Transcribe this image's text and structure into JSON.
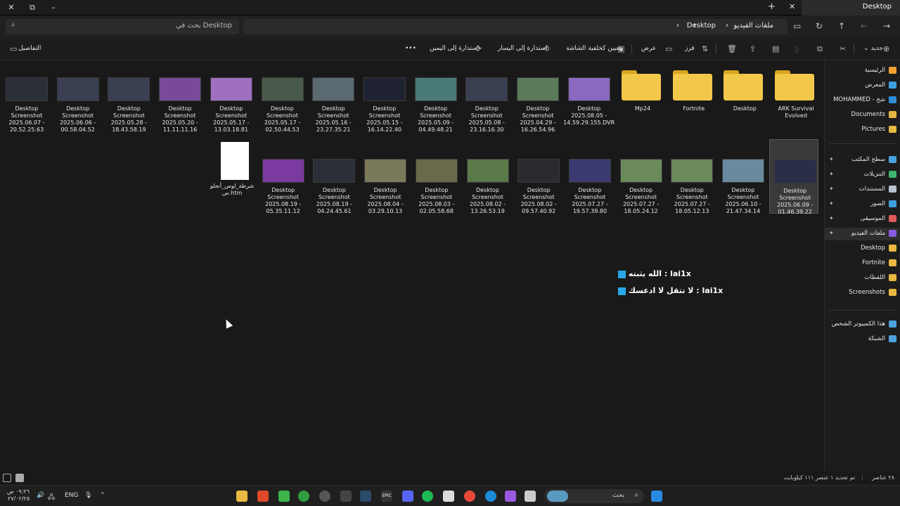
{
  "window": {
    "tab_title": "Desktop",
    "min_icon": "minimize-icon",
    "max_icon": "maximize-icon",
    "close_icon": "close-icon"
  },
  "address": {
    "crumbs": [
      "ملفات الفيديو",
      "Desktop"
    ],
    "search_placeholder": "بحث في Desktop"
  },
  "commands": {
    "new": "جديد",
    "sort": "فرز",
    "view": "عرض",
    "set_wallpaper": "تعيين كخلفية الشاشة",
    "rotate_left": "استدارة إلى اليسار",
    "rotate_right": "استدارة إلى اليمين",
    "more": "•••",
    "details": "التفاصيل"
  },
  "sidebar": {
    "items": [
      {
        "label": "الرئيسية",
        "color": "#f0a030"
      },
      {
        "label": "المعرض",
        "color": "#3da0e0"
      },
      {
        "label": "MOHAMMED - شخ",
        "color": "#2b8bd9"
      },
      {
        "label": "Documents",
        "color": "#e8b840"
      },
      {
        "label": "Pictures",
        "color": "#e8b840"
      },
      {
        "label": "سطح المكتب",
        "color": "#4aa3e0"
      },
      {
        "label": "التنزيلات",
        "color": "#3cb46e"
      },
      {
        "label": "المستندات",
        "color": "#b8c4d0"
      },
      {
        "label": "الصور",
        "color": "#3da0e0"
      },
      {
        "label": "الموسيقى",
        "color": "#e05a5a"
      },
      {
        "label": "ملفات الفيديو",
        "color": "#8a5ae0"
      },
      {
        "label": "Desktop",
        "color": "#e8b840"
      },
      {
        "label": "Fortnite",
        "color": "#e8b840"
      },
      {
        "label": "اللقطات",
        "color": "#e8b840"
      },
      {
        "label": "Screenshots",
        "color": "#e8b840"
      },
      {
        "label": "هذا الكمبيوتر الشخص",
        "color": "#4aa3e0"
      },
      {
        "label": "الشبكة",
        "color": "#4aa3e0"
      }
    ]
  },
  "files_row1": [
    {
      "l1": "Desktop",
      "l2": "Screenshot",
      "l3": "2025.06.07 -",
      "l4": "20.52.25.63",
      "color": "#2a2f38"
    },
    {
      "l1": "Desktop",
      "l2": "Screenshot",
      "l3": "2025.06.06 -",
      "l4": "00.58.04.52",
      "color": "#3a3f52"
    },
    {
      "l1": "Desktop",
      "l2": "Screenshot",
      "l3": "2025.05.28 -",
      "l4": "18.43.58.19",
      "color": "#3a3f52"
    },
    {
      "l1": "Desktop",
      "l2": "Screenshot",
      "l3": "2025.05.20 -",
      "l4": "11.11.11.16",
      "color": "#7a4a9a"
    },
    {
      "l1": "Desktop",
      "l2": "Screenshot",
      "l3": "2025.05.17 -",
      "l4": "13.03.18.81",
      "color": "#a070c0"
    },
    {
      "l1": "Desktop",
      "l2": "Screenshot",
      "l3": "2025.05.17 -",
      "l4": "02.50.44.53",
      "color": "#4a5a4a"
    },
    {
      "l1": "Desktop",
      "l2": "Screenshot",
      "l3": "2025.05.16 -",
      "l4": "23.27.35.21",
      "color": "#5a6a70"
    },
    {
      "l1": "Desktop",
      "l2": "Screenshot",
      "l3": "2025.05.15 -",
      "l4": "16.14.22.40",
      "color": "#1f2230"
    },
    {
      "l1": "Desktop",
      "l2": "Screenshot",
      "l3": "2025.05.09 -",
      "l4": "04.49.48.21",
      "color": "#4a7a78"
    },
    {
      "l1": "Desktop",
      "l2": "Screenshot",
      "l3": "2025.05.08 -",
      "l4": "23.16.16.30",
      "color": "#3a3f52"
    },
    {
      "l1": "Desktop",
      "l2": "Screenshot",
      "l3": "2025.04.29 -",
      "l4": "16.26.54.96",
      "color": "#5a7a5a"
    },
    {
      "l1": "Desktop",
      "l2": "2025.08.05 -",
      "l3": "14.59.29.155.DVR",
      "l4": "",
      "color": "#8a6ac0"
    }
  ],
  "folders": [
    {
      "label": "Mp24"
    },
    {
      "label": "Fortnite"
    },
    {
      "label": "Desktop"
    },
    {
      "label": "ARK Survival Evolved"
    }
  ],
  "files_row2": [
    {
      "l1": "شرطة_لوس_أنجلو",
      "l2": "س.htm",
      "l3": "",
      "l4": "",
      "color": "#ffffff"
    },
    {
      "l1": "Desktop",
      "l2": "Screenshot",
      "l3": "2025.08.19 -",
      "l4": "05.35.11.12",
      "color": "#7a3aa0"
    },
    {
      "l1": "Desktop",
      "l2": "Screenshot",
      "l3": "2025.08.19 -",
      "l4": "04.24.45.61",
      "color": "#2a2f38"
    },
    {
      "l1": "Desktop",
      "l2": "Screenshot",
      "l3": "2025.08.04 -",
      "l4": "03.29.10.13",
      "color": "#7a7a5a"
    },
    {
      "l1": "Desktop",
      "l2": "Screenshot",
      "l3": "2025.08.03 -",
      "l4": "02.05.58.68",
      "color": "#6a6a4a"
    },
    {
      "l1": "Desktop",
      "l2": "Screenshot",
      "l3": "2025.08.02 -",
      "l4": "13.26.53.19",
      "color": "#5a7a4a"
    },
    {
      "l1": "Desktop",
      "l2": "Screenshot",
      "l3": "2025.08.02 -",
      "l4": "09.57.40.92",
      "color": "#2a2a30"
    },
    {
      "l1": "Desktop",
      "l2": "Screenshot",
      "l3": "2025.07.27 -",
      "l4": "19.57.39.80",
      "color": "#3a3a70"
    },
    {
      "l1": "Desktop",
      "l2": "Screenshot",
      "l3": "2025.07.27 -",
      "l4": "18.05.24.12",
      "color": "#6a8a5a"
    },
    {
      "l1": "Desktop",
      "l2": "Screenshot",
      "l3": "2025.07.27 -",
      "l4": "18.05.12.13",
      "color": "#6a8a5a"
    },
    {
      "l1": "Desktop",
      "l2": "Screenshot",
      "l3": "2025.06.10 -",
      "l4": "21.47.34.14",
      "color": "#6a8aa0"
    },
    {
      "l1": "Desktop",
      "l2": "Screenshot",
      "l3": "2025.06.09 -",
      "l4": "01.46.39.22",
      "color": "#2a2e48"
    }
  ],
  "overlay": {
    "line1": "الله يثبته : lai1x",
    "line2": "لا تتقل لا ادعسك : lai1x"
  },
  "status": {
    "count": "٢٨ عناصر",
    "selected": "تم تحديد ١ عنصر ١١١ كيلوبايت"
  },
  "taskbar": {
    "search_placeholder": "بحث",
    "lang": "ENG",
    "time": "٠٩:٢٦ ص",
    "date": "٢٧/٠٢/٢٥"
  }
}
